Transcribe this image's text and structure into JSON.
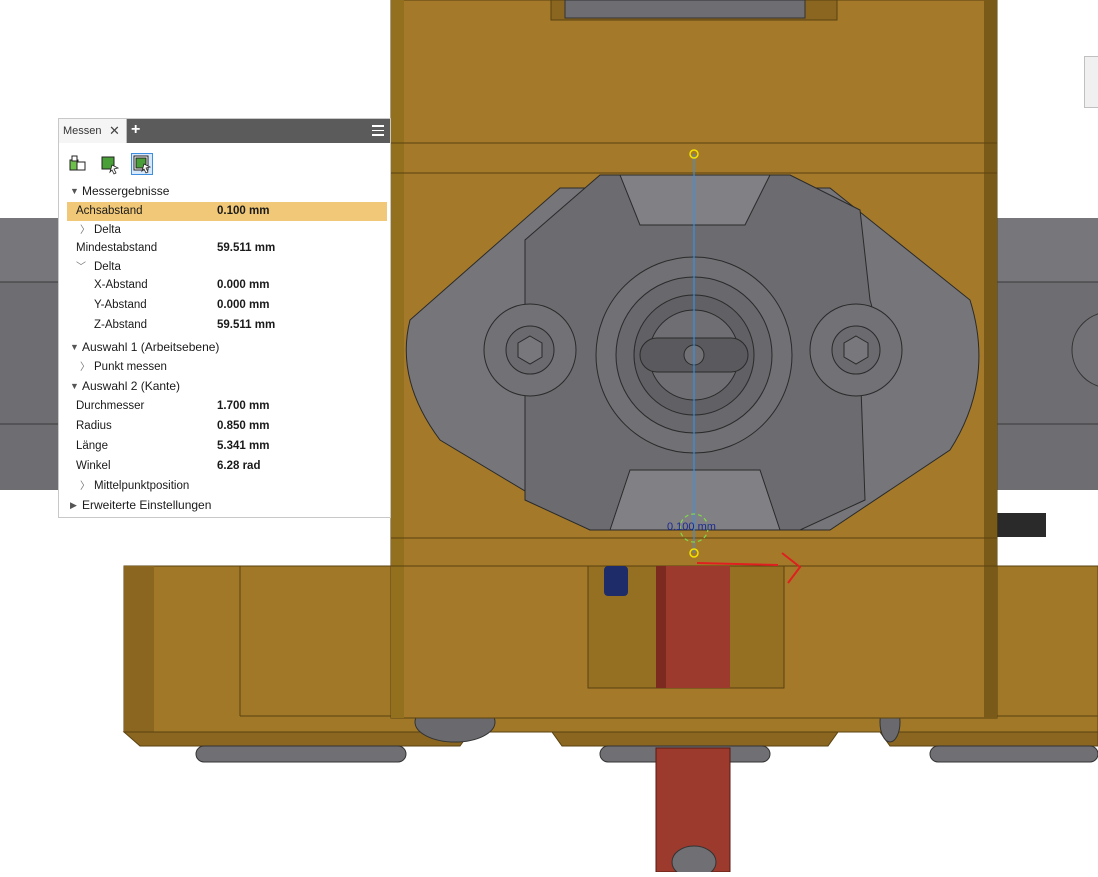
{
  "panel": {
    "tab_label": "Messen",
    "tab_close": "✕",
    "tab_add": "+",
    "sections": {
      "results": "Messergebnisse",
      "selection1": "Auswahl 1 (Arbeitsebene)",
      "selection2": "Auswahl 2 (Kante)",
      "advanced": "Erweiterte Einstellungen"
    },
    "rows": {
      "achsabstand": {
        "label": "Achsabstand",
        "value": "0.100 mm"
      },
      "delta1": "Delta",
      "mindestabstand": {
        "label": "Mindestabstand",
        "value": "59.511 mm"
      },
      "delta2": "Delta",
      "x": {
        "label": "X-Abstand",
        "value": "0.000 mm"
      },
      "y": {
        "label": "Y-Abstand",
        "value": "0.000 mm"
      },
      "z": {
        "label": "Z-Abstand",
        "value": "59.511 mm"
      },
      "punkt_messen": "Punkt messen",
      "durchmesser": {
        "label": "Durchmesser",
        "value": "1.700 mm"
      },
      "radius": {
        "label": "Radius",
        "value": "0.850 mm"
      },
      "laenge": {
        "label": "Länge",
        "value": "5.341 mm"
      },
      "winkel": {
        "label": "Winkel",
        "value": "6.28 rad"
      },
      "mittelpunkt": "Mittelpunktposition"
    }
  },
  "viewport": {
    "dimension_label": "0.100 mm"
  },
  "colors": {
    "part_gold": "#a07828",
    "part_gold_dark": "#7a5a18",
    "part_gray": "#6e6e72",
    "rod_red": "#9c3a2e",
    "highlight": "#f0c878",
    "measure_line": "#3a8fe0",
    "annotation_red": "#e02020"
  }
}
